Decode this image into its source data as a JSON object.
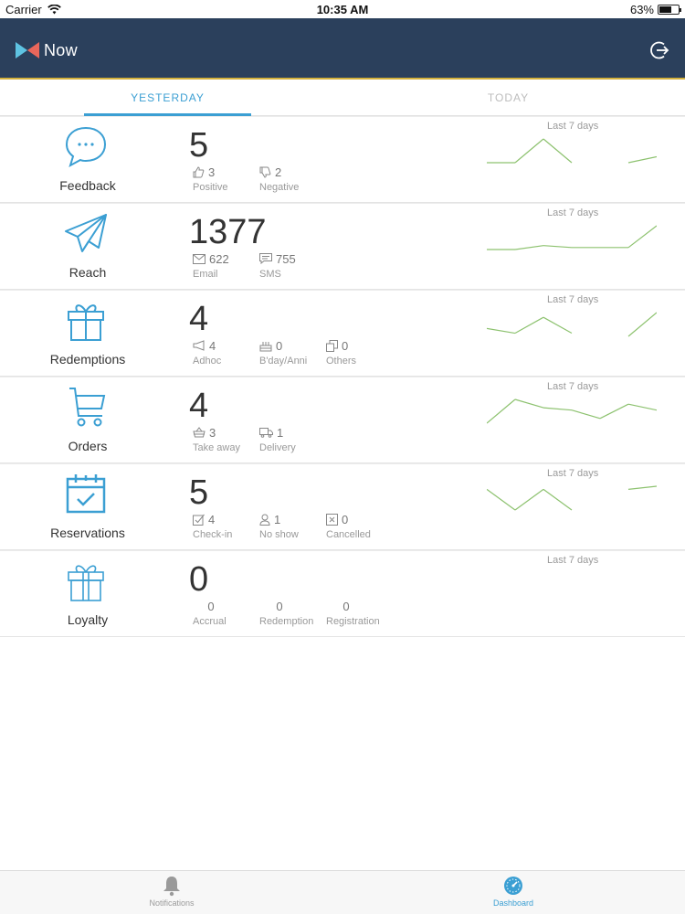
{
  "status_bar": {
    "carrier": "Carrier",
    "time": "10:35 AM",
    "battery": "63%",
    "battery_level": 0.63
  },
  "header": {
    "app_name": "Now"
  },
  "tabs": [
    {
      "label": "YESTERDAY",
      "active": true
    },
    {
      "label": "TODAY",
      "active": false
    }
  ],
  "cards": [
    {
      "label": "Feedback",
      "icon": "chat-bubble-icon",
      "value": "5",
      "spark_title": "Last 7 days",
      "metrics": [
        {
          "icon": "thumbs-up-icon",
          "value": "3",
          "label": "Positive"
        },
        {
          "icon": "thumbs-down-icon",
          "value": "2",
          "label": "Negative"
        }
      ],
      "spark": [
        1,
        1,
        3,
        1,
        null,
        1,
        1.5
      ]
    },
    {
      "label": "Reach",
      "icon": "paper-plane-icon",
      "value": "1377",
      "spark_title": "Last 7 days",
      "metrics": [
        {
          "icon": "envelope-icon",
          "value": "622",
          "label": "Email"
        },
        {
          "icon": "sms-icon",
          "value": "755",
          "label": "SMS"
        }
      ],
      "spark": [
        0,
        0,
        2,
        1,
        1,
        1,
        12
      ]
    },
    {
      "label": "Redemptions",
      "icon": "gift-icon",
      "value": "4",
      "spark_title": "Last 7 days",
      "metrics": [
        {
          "icon": "megaphone-icon",
          "value": "4",
          "label": "Adhoc"
        },
        {
          "icon": "cake-icon",
          "value": "0",
          "label": "B'day/Anni"
        },
        {
          "icon": "copy-icon",
          "value": "0",
          "label": "Others"
        }
      ],
      "spark": [
        1,
        0.7,
        1.7,
        0.7,
        null,
        0.5,
        2
      ]
    },
    {
      "label": "Orders",
      "icon": "cart-icon",
      "value": "4",
      "spark_title": "Last 7 days",
      "metrics": [
        {
          "icon": "basket-icon",
          "value": "3",
          "label": "Take away"
        },
        {
          "icon": "truck-icon",
          "value": "1",
          "label": "Delivery"
        }
      ],
      "spark": [
        2,
        4,
        3.3,
        3.1,
        2.4,
        3.6,
        3.1
      ]
    },
    {
      "label": "Reservations",
      "icon": "calendar-check-icon",
      "value": "5",
      "spark_title": "Last 7 days",
      "metrics": [
        {
          "icon": "checkbox-icon",
          "value": "4",
          "label": "Check-in"
        },
        {
          "icon": "person-icon",
          "value": "1",
          "label": "No show"
        },
        {
          "icon": "x-box-icon",
          "value": "0",
          "label": "Cancelled"
        }
      ],
      "spark": [
        3,
        1,
        3,
        1,
        null,
        3,
        3.3
      ]
    },
    {
      "label": "Loyalty",
      "icon": "gift-icon",
      "value": "0",
      "spark_title": "Last 7 days",
      "metrics": [
        {
          "icon": "",
          "value": "0",
          "label": "Accrual"
        },
        {
          "icon": "",
          "value": "0",
          "label": "Redemption"
        },
        {
          "icon": "",
          "value": "0",
          "label": "Registration"
        }
      ],
      "spark": []
    }
  ],
  "tabbar": {
    "notifications_label": "Notifications",
    "dashboard_label": "Dashboard"
  },
  "colors": {
    "header_bg": "#2b405c",
    "accent": "#3b9fd3",
    "spark_line": "#8dc26f",
    "header_border": "#d4b13c"
  }
}
